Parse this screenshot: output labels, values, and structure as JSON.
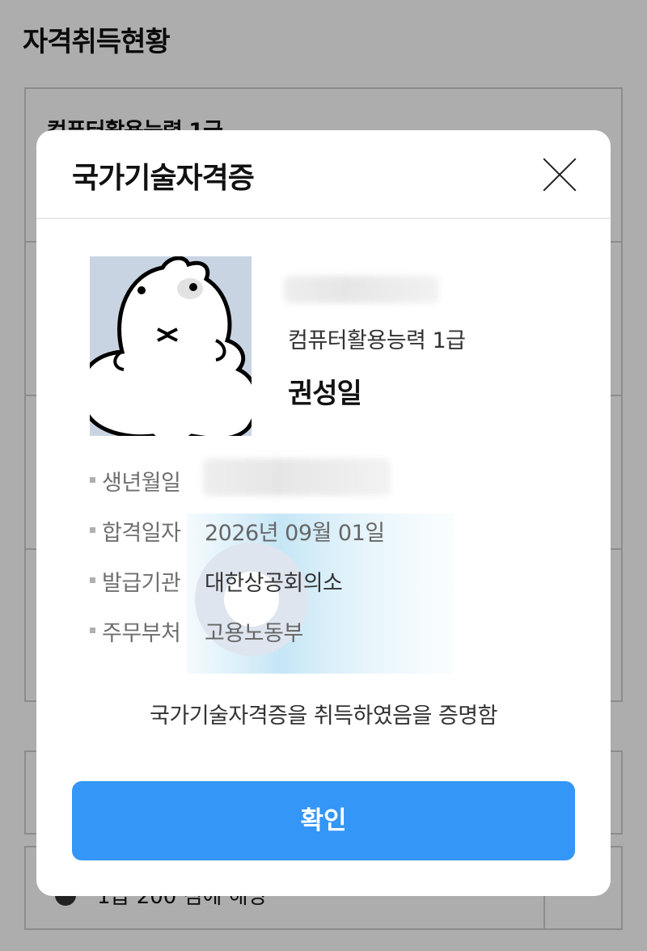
{
  "background": {
    "page_title": "자격취득현황",
    "card_title": "컴퓨터활용능력 1급",
    "footer_text": "1급 200 점에 해당"
  },
  "modal": {
    "title": "국가기술자격증",
    "cert_name": "컴퓨터활용능력 1급",
    "holder_name": "권성일",
    "fields": [
      {
        "label": "생년월일",
        "value": ""
      },
      {
        "label": "합격일자",
        "value": "2026년 09월 01일"
      },
      {
        "label": "발급기관",
        "value": "대한상공회의소"
      },
      {
        "label": "주무부처",
        "value": "고용노동부"
      }
    ],
    "certify_text": "국가기술자격증을 취득하였음을 증명함",
    "confirm_label": "확인"
  },
  "colors": {
    "accent": "#3496f7",
    "overlay": "#000000"
  },
  "icons": {
    "close": "close-icon",
    "photo": "avatar-photo",
    "watermark": "gear-watermark"
  }
}
